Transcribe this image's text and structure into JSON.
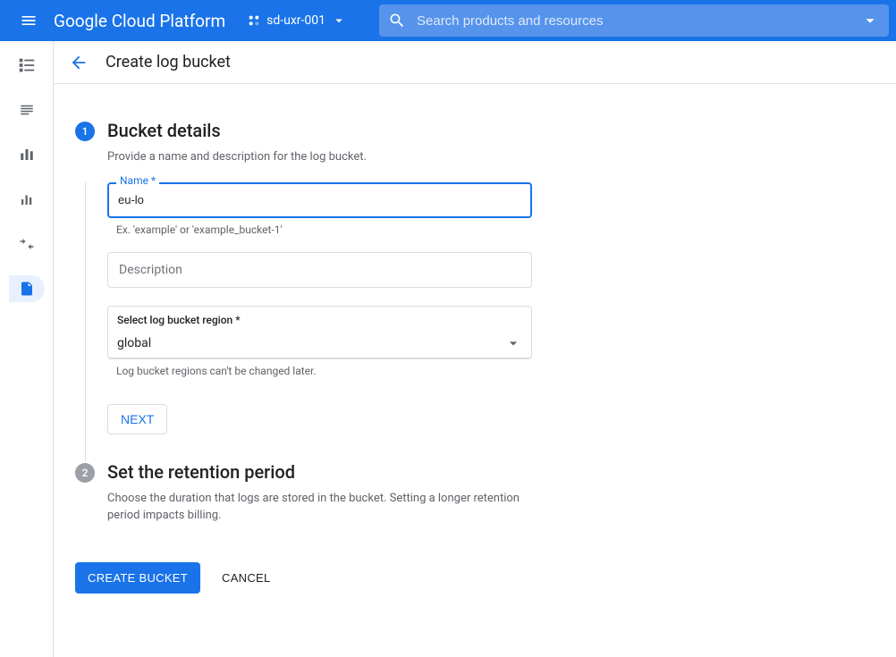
{
  "header": {
    "brand": "Google Cloud Platform",
    "project": "sd-uxr-001",
    "search_placeholder": "Search products and resources"
  },
  "page": {
    "title": "Create log bucket"
  },
  "steps": {
    "s1": {
      "number": "1",
      "title": "Bucket details",
      "subtitle": "Provide a name and description for the log bucket.",
      "name_label": "Name *",
      "name_value": "eu-lo",
      "name_helper": "Ex. 'example' or 'example_bucket-1'",
      "description_placeholder": "Description",
      "region_label": "Select log bucket region *",
      "region_value": "global",
      "region_helper": "Log bucket regions can't be changed later.",
      "next_label": "NEXT"
    },
    "s2": {
      "number": "2",
      "title": "Set the retention period",
      "subtitle": "Choose the duration that logs are stored in the bucket. Setting a longer retention period impacts billing."
    }
  },
  "actions": {
    "create": "CREATE BUCKET",
    "cancel": "CANCEL"
  }
}
